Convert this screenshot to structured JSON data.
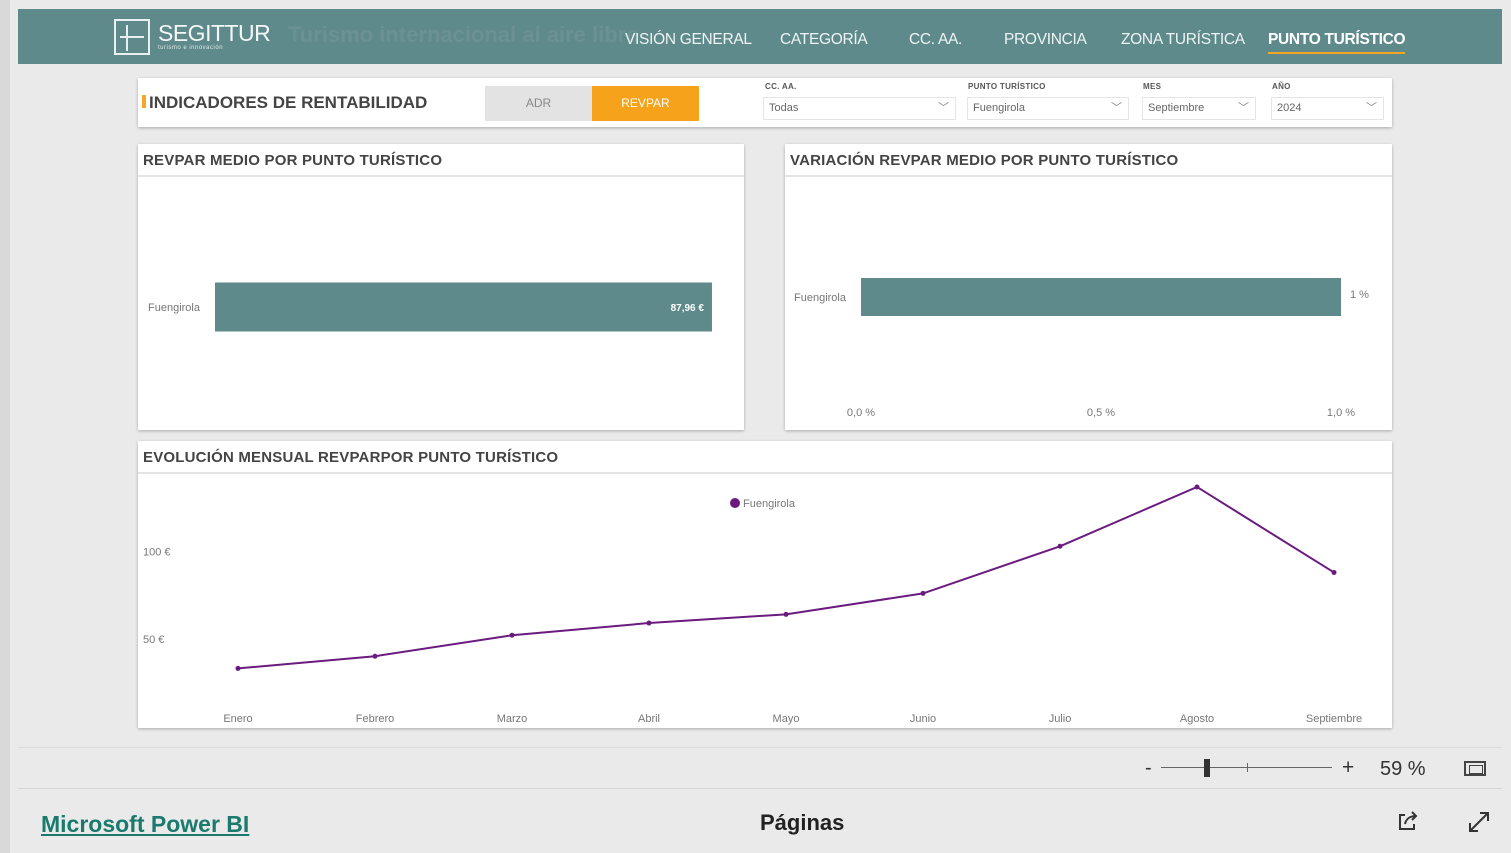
{
  "header": {
    "logo_text": "SEGITTUR",
    "logo_subtitle": "turismo e innovación",
    "background_title": "Turismo internacional al aire libre",
    "nav": [
      {
        "label": "VISIÓN GENERAL",
        "active": false
      },
      {
        "label": "CATEGORÍA",
        "active": false
      },
      {
        "label": "CC. AA.",
        "active": false
      },
      {
        "label": "PROVINCIA",
        "active": false
      },
      {
        "label": "ZONA TURÍSTICA",
        "active": false
      },
      {
        "label": "PUNTO TURÍSTICO",
        "active": true
      }
    ]
  },
  "filters": {
    "section_title": "INDICADORES DE RENTABILIDAD",
    "toggle_options": [
      {
        "label": "ADR",
        "selected": false
      },
      {
        "label": "REVPAR",
        "selected": true
      }
    ],
    "selects": [
      {
        "label": "CC. AA.",
        "value": "Todas"
      },
      {
        "label": "PUNTO TURÍSTICO",
        "value": "Fuengirola"
      },
      {
        "label": "MES",
        "value": "Septiembre"
      },
      {
        "label": "AÑO",
        "value": "2024"
      }
    ]
  },
  "chart_data": [
    {
      "type": "bar",
      "orientation": "horizontal",
      "title": "REVPAR MEDIO POR PUNTO TURÍSTICO",
      "categories": [
        "Fuengirola"
      ],
      "values": [
        87.96
      ],
      "value_labels": [
        "87,96 €"
      ],
      "xlim": [
        0,
        100
      ],
      "color": "#5f8a8b",
      "grid": false
    },
    {
      "type": "bar",
      "orientation": "horizontal",
      "title": "VARIACIÓN REVPAR MEDIO POR PUNTO TURÍSTICO",
      "categories": [
        "Fuengirola"
      ],
      "values": [
        1.0
      ],
      "value_labels": [
        "1 %"
      ],
      "xticks": [
        0,
        0.5,
        1.0
      ],
      "xtick_labels": [
        "0,0 %",
        "0,5 %",
        "1,0 %"
      ],
      "xlim": [
        0,
        1.0
      ],
      "color": "#5f8a8b",
      "grid": false
    },
    {
      "type": "line",
      "title": "EVOLUCIÓN MENSUAL REVPARPOR PUNTO TURÍSTICO",
      "categories": [
        "Enero",
        "Febrero",
        "Marzo",
        "Abril",
        "Mayo",
        "Junio",
        "Julio",
        "Agosto",
        "Septiembre"
      ],
      "series": [
        {
          "name": "Fuengirola",
          "values": [
            33,
            40,
            52,
            59,
            64,
            76,
            103,
            137,
            88
          ],
          "color": "#6b1b7f"
        }
      ],
      "yticks": [
        50,
        100
      ],
      "ytick_labels": [
        "50 €",
        "100 €"
      ],
      "ylim": [
        0,
        145
      ],
      "legend_position": "top-center",
      "grid": false
    }
  ],
  "zoom": {
    "minus": "-",
    "plus": "+",
    "value": "59 %"
  },
  "footer": {
    "link": "Microsoft Power BI",
    "pages": "Páginas"
  },
  "colors": {
    "header": "#5f8a8b",
    "accent": "#f7a21b",
    "bar": "#5f8a8b",
    "line": "#6b1b7f"
  }
}
